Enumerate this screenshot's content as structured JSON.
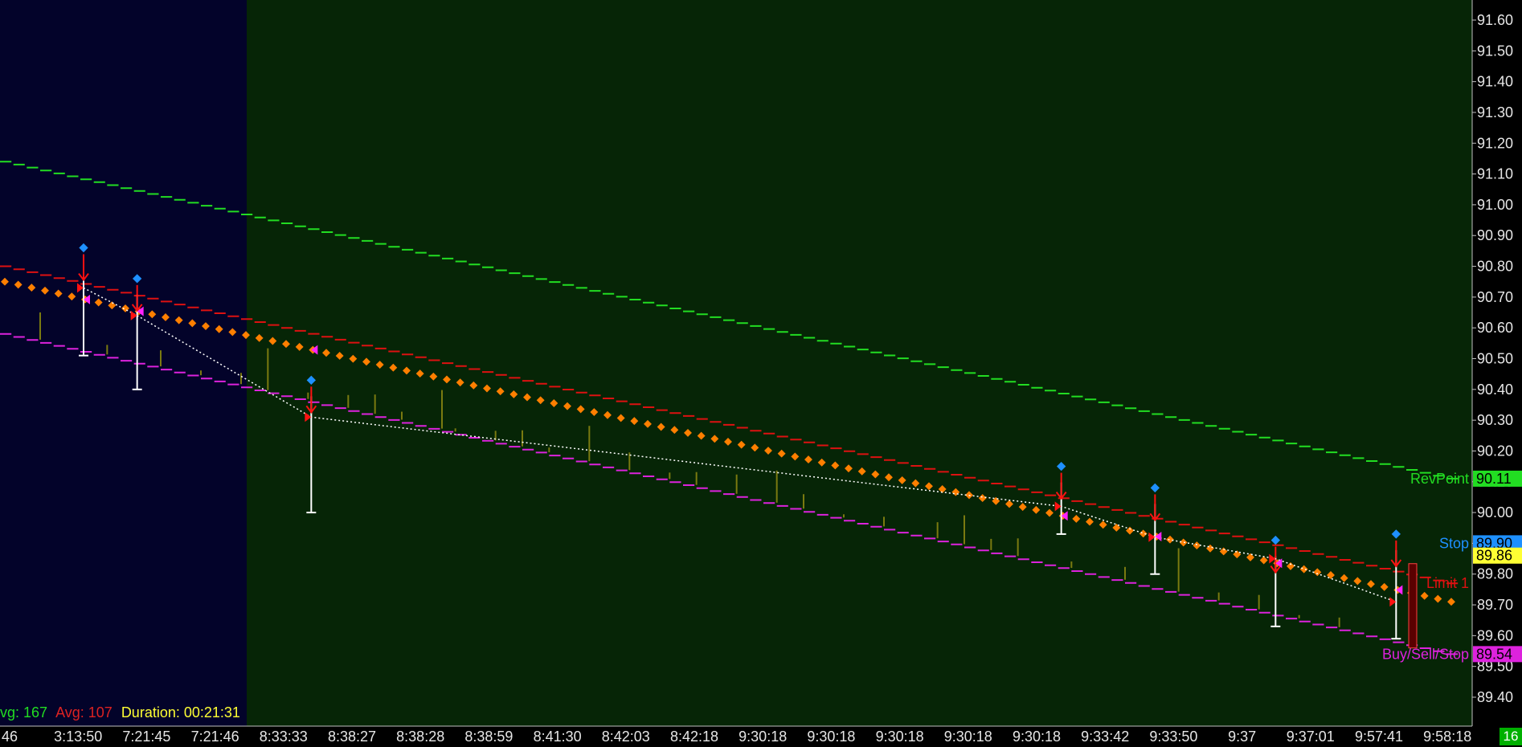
{
  "chart_data": {
    "type": "line",
    "colors": {
      "bg_session1": "#03032a",
      "bg_session2": "#062506",
      "rev_point": "#22dd22",
      "limit": "#dd1111",
      "stop_dots": "#ff7f00",
      "buy_sell_stop": "#dd22dd",
      "trend": "#ffffff",
      "volume": "#7a7a10",
      "marker_blue": "#1e90ff"
    },
    "y_axis": {
      "ticks": [
        "91.60",
        "91.50",
        "91.40",
        "91.30",
        "91.20",
        "91.10",
        "91.00",
        "90.90",
        "90.80",
        "90.70",
        "90.60",
        "90.50",
        "90.40",
        "90.30",
        "90.20",
        "90.10",
        "90.00",
        "89.90",
        "89.80",
        "89.70",
        "89.60",
        "89.50",
        "89.40"
      ],
      "ylim": [
        89.4,
        91.6
      ]
    },
    "x_axis": {
      "ticks": [
        "46",
        "3:13:50",
        "7:21:45",
        "7:21:46",
        "8:33:33",
        "8:38:27",
        "8:38:28",
        "8:38:59",
        "8:41:30",
        "8:42:03",
        "8:42:18",
        "9:30:18",
        "9:30:18",
        "9:30:18",
        "9:30:18",
        "9:30:18",
        "9:33:42",
        "9:33:50",
        "9:37",
        "9:37:01",
        "9:57:41",
        "9:58:18"
      ]
    },
    "series": [
      {
        "name": "RevPoint",
        "start": 91.14,
        "end": 90.11
      },
      {
        "name": "Limit 1",
        "start": 90.8,
        "end": 89.77
      },
      {
        "name": "Stop",
        "start": 90.75,
        "end": 89.71
      },
      {
        "name": "Buy/Sell/Stop",
        "start": 90.58,
        "end": 89.54
      }
    ],
    "price_tags": [
      {
        "value": "90.11",
        "label": "RevPoint",
        "color": "#22dd22",
        "text_color": "#000000"
      },
      {
        "value": "89.90",
        "label": "Stop",
        "color": "#1e90ff",
        "text_color": "#1e90ff"
      },
      {
        "value": "89.86",
        "label": "",
        "color": "#ffff33",
        "text_color": "#000000"
      },
      {
        "value": "89.54",
        "label": "Buy/Sell/Stop",
        "color": "#dd22dd",
        "text_color": "#000000"
      }
    ],
    "limit_label": "Limit 1",
    "limit_value": 89.77,
    "bars": [
      {
        "x": 6,
        "high": 90.86,
        "low": 90.51
      },
      {
        "x": 10,
        "high": 90.76,
        "low": 90.4
      },
      {
        "x": 23,
        "high": 90.43,
        "low": 90.0
      },
      {
        "x": 79,
        "high": 90.15,
        "low": 89.93
      },
      {
        "x": 86,
        "high": 90.08,
        "low": 89.8
      },
      {
        "x": 95,
        "high": 89.91,
        "low": 89.63
      },
      {
        "x": 104,
        "high": 89.93,
        "low": 89.59
      }
    ],
    "trend_points": [
      {
        "x": 6,
        "y": 90.73
      },
      {
        "x": 10,
        "y": 90.64
      },
      {
        "x": 23,
        "y": 90.31
      },
      {
        "x": 79,
        "y": 90.02
      },
      {
        "x": 86,
        "y": 89.92
      },
      {
        "x": 95,
        "y": 89.85
      },
      {
        "x": 104,
        "y": 89.71
      }
    ],
    "blue_markers": [
      {
        "x": 6,
        "y": 90.86
      },
      {
        "x": 10,
        "y": 90.76
      },
      {
        "x": 23,
        "y": 90.43
      },
      {
        "x": 79,
        "y": 90.15
      },
      {
        "x": 86,
        "y": 90.08
      },
      {
        "x": 95,
        "y": 89.91
      },
      {
        "x": 104,
        "y": 89.93
      }
    ]
  },
  "status": {
    "vol_label": "vg: 167",
    "avg_label": "Avg: 107",
    "duration_label": "Duration: 00:21:31"
  },
  "corner_badge": "16"
}
